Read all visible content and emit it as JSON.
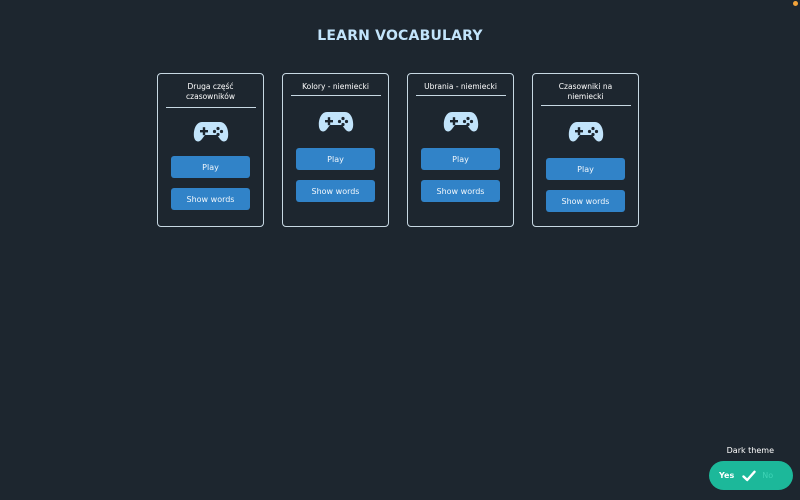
{
  "page": {
    "title": "LEARN VOCABULARY"
  },
  "cards": [
    {
      "title": "Druga część czasowników",
      "icon": "gamepad-icon",
      "play_label": "Play",
      "show_words_label": "Show words"
    },
    {
      "title": "Kolory - niemiecki",
      "icon": "gamepad-icon",
      "play_label": "Play",
      "show_words_label": "Show words"
    },
    {
      "title": "Ubrania - niemiecki",
      "icon": "gamepad-icon",
      "play_label": "Play",
      "show_words_label": "Show words"
    },
    {
      "title": "Czasowniki na niemiecki",
      "icon": "gamepad-icon",
      "play_label": "Play",
      "show_words_label": "Show words"
    }
  ],
  "theme": {
    "label": "Dark theme",
    "yes_label": "Yes",
    "no_label": "No",
    "enabled": true
  },
  "colors": {
    "background": "#1d262f",
    "accent_button": "#3183c8",
    "title_color": "#c2e4fb",
    "toggle_on": "#1cb89a"
  }
}
